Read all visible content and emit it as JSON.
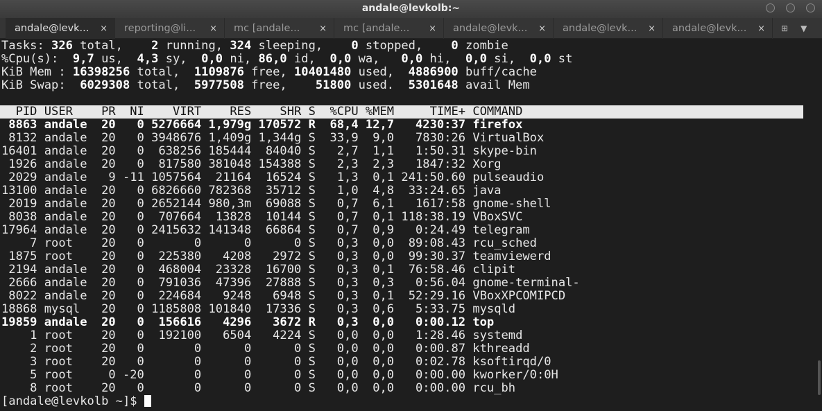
{
  "window": {
    "title": "andale@levkolb:~"
  },
  "tabs": [
    {
      "label": "andale@levk...",
      "active": true
    },
    {
      "label": "reporting@li..."
    },
    {
      "label": "mc [andale..."
    },
    {
      "label": "mc [andale..."
    },
    {
      "label": "andale@levk..."
    },
    {
      "label": "andale@levk..."
    },
    {
      "label": "andale@levk..."
    }
  ],
  "tab_close": "×",
  "summary": [
    [
      [
        "Tasks: ",
        0
      ],
      [
        "326",
        1
      ],
      [
        " total,    ",
        0
      ],
      [
        "2",
        1
      ],
      [
        " running, ",
        0
      ],
      [
        "324",
        1
      ],
      [
        " sleeping,    ",
        0
      ],
      [
        "0",
        1
      ],
      [
        " stopped,    ",
        0
      ],
      [
        "0",
        1
      ],
      [
        " zombie",
        0
      ]
    ],
    [
      [
        "%Cpu(s):  ",
        0
      ],
      [
        "9,7",
        1
      ],
      [
        " us,  ",
        0
      ],
      [
        "4,3",
        1
      ],
      [
        " sy,  ",
        0
      ],
      [
        "0,0",
        1
      ],
      [
        " ni, ",
        0
      ],
      [
        "86,0",
        1
      ],
      [
        " id,  ",
        0
      ],
      [
        "0,0",
        1
      ],
      [
        " wa,   ",
        0
      ],
      [
        "0,0",
        1
      ],
      [
        " hi,  ",
        0
      ],
      [
        "0,0",
        1
      ],
      [
        " si,  ",
        0
      ],
      [
        "0,0",
        1
      ],
      [
        " st",
        0
      ]
    ],
    [
      [
        "KiB Mem : ",
        0
      ],
      [
        "16398256",
        1
      ],
      [
        " total,  ",
        0
      ],
      [
        "1109876",
        1
      ],
      [
        " free, ",
        0
      ],
      [
        "10401480",
        1
      ],
      [
        " used,  ",
        0
      ],
      [
        "4886900",
        1
      ],
      [
        " buff/cache",
        0
      ]
    ],
    [
      [
        "KiB Swap:  ",
        0
      ],
      [
        "6029308",
        1
      ],
      [
        " total,  ",
        0
      ],
      [
        "5977508",
        1
      ],
      [
        " free,    ",
        0
      ],
      [
        "51800",
        1
      ],
      [
        " used.  ",
        0
      ],
      [
        "5301648",
        1
      ],
      [
        " avail Mem",
        0
      ]
    ]
  ],
  "table": {
    "headers": [
      "PID",
      "USER",
      "PR",
      "NI",
      "VIRT",
      "RES",
      "SHR",
      "S",
      "%CPU",
      "%MEM",
      "TIME+",
      "COMMAND"
    ],
    "rows": [
      [
        "8863",
        "andale",
        "20",
        "0",
        "5276664",
        "1,979g",
        "170572",
        "R",
        "68,4",
        "12,7",
        "4230:37",
        "firefox"
      ],
      [
        "8132",
        "andale",
        "20",
        "0",
        "3948676",
        "1,409g",
        "1,344g",
        "S",
        "33,9",
        "9,0",
        "7830:26",
        "VirtualBox"
      ],
      [
        "16401",
        "andale",
        "20",
        "0",
        "638256",
        "185444",
        "84040",
        "S",
        "2,7",
        "1,1",
        "1:50.31",
        "skype-bin"
      ],
      [
        "1926",
        "andale",
        "20",
        "0",
        "817580",
        "381048",
        "154388",
        "S",
        "2,3",
        "2,3",
        "1847:32",
        "Xorg"
      ],
      [
        "2029",
        "andale",
        "9",
        "-11",
        "1057564",
        "21164",
        "16524",
        "S",
        "1,3",
        "0,1",
        "241:50.60",
        "pulseaudio"
      ],
      [
        "13100",
        "andale",
        "20",
        "0",
        "6826660",
        "782368",
        "35712",
        "S",
        "1,0",
        "4,8",
        "33:24.65",
        "java"
      ],
      [
        "2019",
        "andale",
        "20",
        "0",
        "2652144",
        "980,3m",
        "69088",
        "S",
        "0,7",
        "6,1",
        "1617:58",
        "gnome-shell"
      ],
      [
        "8038",
        "andale",
        "20",
        "0",
        "707664",
        "13828",
        "10144",
        "S",
        "0,7",
        "0,1",
        "118:38.19",
        "VBoxSVC"
      ],
      [
        "17964",
        "andale",
        "20",
        "0",
        "2415632",
        "141348",
        "66864",
        "S",
        "0,7",
        "0,9",
        "0:24.49",
        "telegram"
      ],
      [
        "7",
        "root",
        "20",
        "0",
        "0",
        "0",
        "0",
        "S",
        "0,3",
        "0,0",
        "89:08.43",
        "rcu_sched"
      ],
      [
        "1875",
        "root",
        "20",
        "0",
        "225380",
        "4208",
        "2972",
        "S",
        "0,3",
        "0,0",
        "99:30.37",
        "teamviewerd"
      ],
      [
        "2194",
        "andale",
        "20",
        "0",
        "468004",
        "23328",
        "16700",
        "S",
        "0,3",
        "0,1",
        "76:58.46",
        "clipit"
      ],
      [
        "2666",
        "andale",
        "20",
        "0",
        "791036",
        "47396",
        "27888",
        "S",
        "0,3",
        "0,3",
        "0:56.04",
        "gnome-terminal-"
      ],
      [
        "8022",
        "andale",
        "20",
        "0",
        "224684",
        "9248",
        "6948",
        "S",
        "0,3",
        "0,1",
        "52:29.16",
        "VBoxXPCOMIPCD"
      ],
      [
        "18868",
        "mysql",
        "20",
        "0",
        "1185808",
        "101840",
        "17336",
        "S",
        "0,3",
        "0,6",
        "5:33.75",
        "mysqld"
      ],
      [
        "19859",
        "andale",
        "20",
        "0",
        "156616",
        "4296",
        "3672",
        "R",
        "0,3",
        "0,0",
        "0:00.12",
        "top"
      ],
      [
        "1",
        "root",
        "20",
        "0",
        "192100",
        "6504",
        "4224",
        "S",
        "0,0",
        "0,0",
        "1:28.46",
        "systemd"
      ],
      [
        "2",
        "root",
        "20",
        "0",
        "0",
        "0",
        "0",
        "S",
        "0,0",
        "0,0",
        "0:00.87",
        "kthreadd"
      ],
      [
        "3",
        "root",
        "20",
        "0",
        "0",
        "0",
        "0",
        "S",
        "0,0",
        "0,0",
        "0:02.78",
        "ksoftirqd/0"
      ],
      [
        "5",
        "root",
        "0",
        "-20",
        "0",
        "0",
        "0",
        "S",
        "0,0",
        "0,0",
        "0:00.00",
        "kworker/0:0H"
      ],
      [
        "8",
        "root",
        "20",
        "0",
        "0",
        "0",
        "0",
        "S",
        "0,0",
        "0,0",
        "0:00.00",
        "rcu_bh"
      ]
    ]
  },
  "prompt": "[andale@levkolb ~]$ "
}
